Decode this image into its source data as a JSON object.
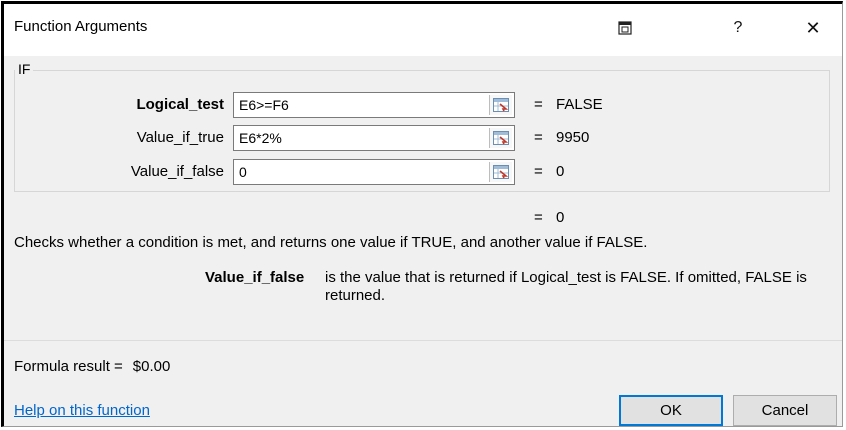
{
  "window": {
    "title": "Function Arguments",
    "help_glyph": "?",
    "close_glyph": "✕",
    "restore_icon": "collapse-dialog-icon"
  },
  "function": {
    "name": "IF",
    "arguments": [
      {
        "label": "Logical_test",
        "value": "E6>=F6",
        "result": "FALSE",
        "bold": true
      },
      {
        "label": "Value_if_true",
        "value": "E6*2%",
        "result": "9950",
        "bold": false
      },
      {
        "label": "Value_if_false",
        "value": "0",
        "result": "0",
        "bold": false
      }
    ],
    "equals": "=",
    "overall_result": "0",
    "description": "Checks whether a condition is met, and returns one value if TRUE, and another value if FALSE.",
    "arg_help_name": "Value_if_false",
    "arg_help_text": "is the value that is returned if Logical_test is FALSE. If omitted, FALSE is returned."
  },
  "footer": {
    "formula_label": "Formula result =",
    "formula_value": "$0.00",
    "help_link": "Help on this function",
    "ok_label": "OK",
    "cancel_label": "Cancel"
  },
  "colors": {
    "dialog_bg": "#f0f0f0",
    "link": "#0066cc",
    "ok_border": "#0078d7"
  }
}
